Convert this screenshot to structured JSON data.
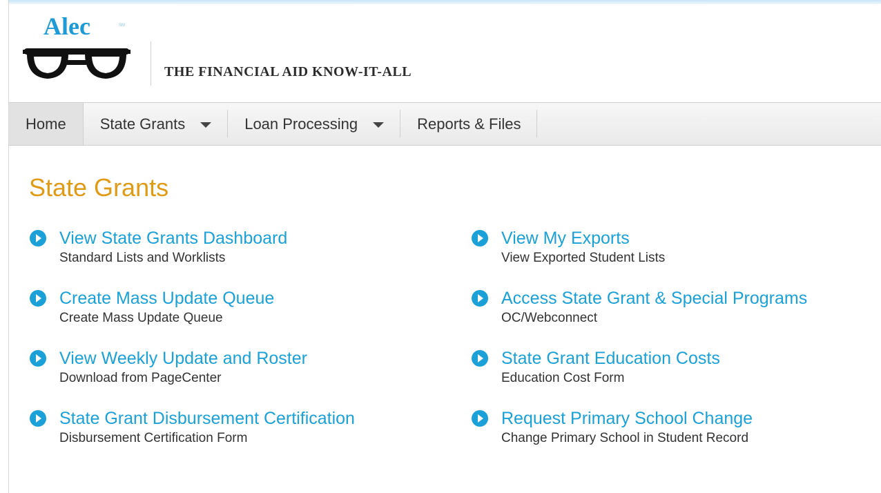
{
  "header": {
    "logo_text": "Alec",
    "logo_tm": "SM",
    "tagline": "THE FINANCIAL AID KNOW-IT-ALL"
  },
  "nav": {
    "items": [
      {
        "label": "Home",
        "active": true,
        "dropdown": false
      },
      {
        "label": "State Grants",
        "active": false,
        "dropdown": true
      },
      {
        "label": "Loan Processing",
        "active": false,
        "dropdown": true
      },
      {
        "label": "Reports & Files",
        "active": false,
        "dropdown": false
      }
    ]
  },
  "main": {
    "title": "State Grants",
    "links": [
      {
        "title": "View State Grants Dashboard",
        "subtitle": "Standard Lists and Worklists"
      },
      {
        "title": "View My Exports",
        "subtitle": "View Exported Student Lists"
      },
      {
        "title": "Create Mass Update Queue",
        "subtitle": "Create Mass Update Queue"
      },
      {
        "title": "Access State Grant & Special Programs",
        "subtitle": "OC/Webconnect"
      },
      {
        "title": "View Weekly Update and Roster",
        "subtitle": "Download from PageCenter"
      },
      {
        "title": "State Grant Education Costs",
        "subtitle": "Education Cost Form"
      },
      {
        "title": "State Grant Disbursement Certification",
        "subtitle": "Disbursement Certification Form"
      },
      {
        "title": "Request Primary School Change",
        "subtitle": "Change Primary School in Student Record"
      }
    ]
  },
  "colors": {
    "title": "#e09b16",
    "link": "#1ba1d8",
    "logo": "#1e9ad6"
  }
}
